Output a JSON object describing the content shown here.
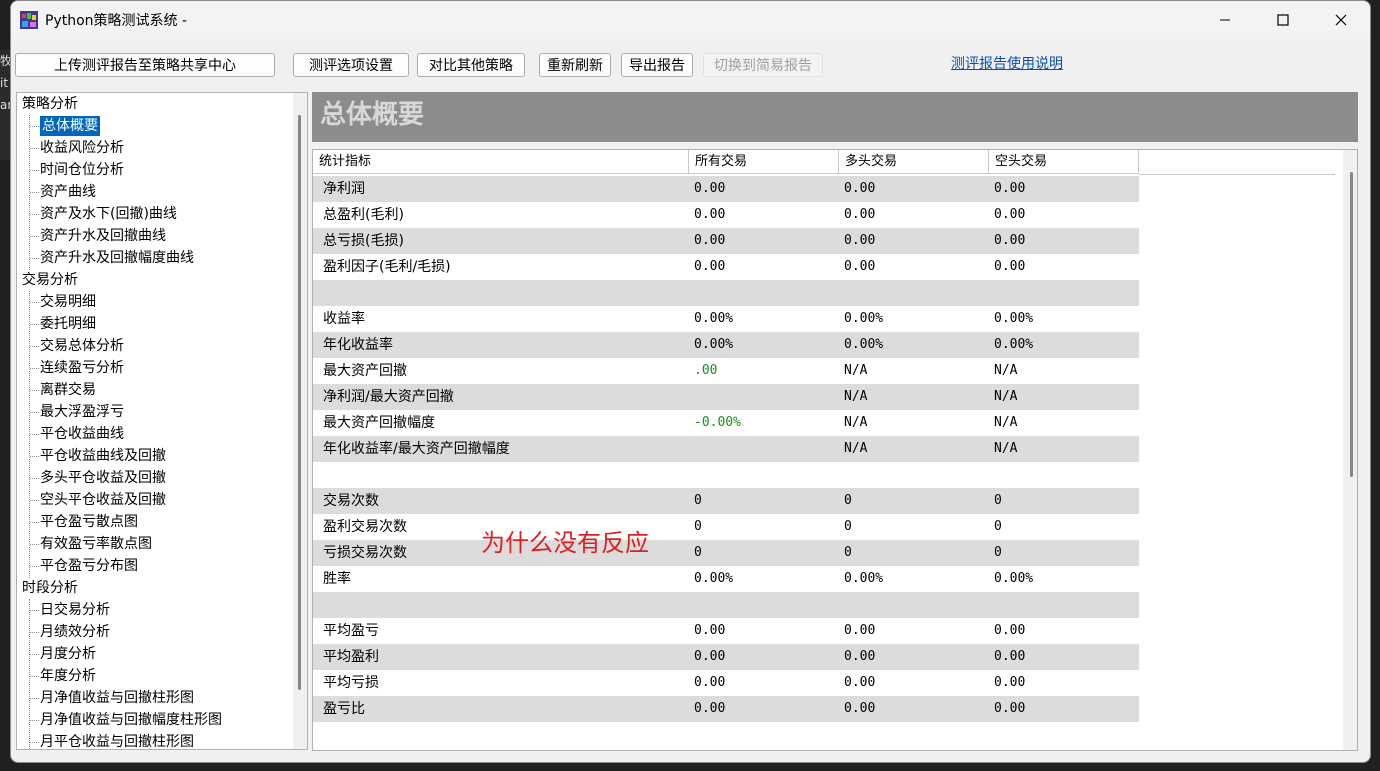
{
  "window": {
    "title": "Python策略测试系统 -"
  },
  "edge_fragments": [
    "牧",
    "it",
    "ar"
  ],
  "toolbar": {
    "upload": "上传测评报告至策略共享中心",
    "options": "测评选项设置",
    "compare": "对比其他策略",
    "refresh": "重新刷新",
    "export": "导出报告",
    "simple": "切换到简易报告",
    "help": "测评报告使用说明"
  },
  "tree": {
    "groups": [
      {
        "label": "策略分析",
        "items": [
          "总体概要",
          "收益风险分析",
          "时间仓位分析",
          "资产曲线",
          "资产及水下(回撤)曲线",
          "资产升水及回撤曲线",
          "资产升水及回撤幅度曲线"
        ]
      },
      {
        "label": "交易分析",
        "items": [
          "交易明细",
          "委托明细",
          "交易总体分析",
          "连续盈亏分析",
          "离群交易",
          "最大浮盈浮亏",
          "平仓收益曲线",
          "平仓收益曲线及回撤",
          "多头平仓收益及回撤",
          "空头平仓收益及回撤",
          "平仓盈亏散点图",
          "有效盈亏率散点图",
          "平仓盈亏分布图"
        ]
      },
      {
        "label": "时段分析",
        "items": [
          "日交易分析",
          "月绩效分析",
          "月度分析",
          "年度分析",
          "月净值收益与回撤柱形图",
          "月净值收益与回撤幅度柱形图",
          "月平仓收益与回撤柱形图"
        ]
      }
    ]
  },
  "panel": {
    "title": "总体概要"
  },
  "table": {
    "headers": [
      "统计指标",
      "所有交易",
      "多头交易",
      "空头交易"
    ],
    "rows": [
      {
        "label": "净利润",
        "all": "0.00",
        "long": "0.00",
        "short": "0.00"
      },
      {
        "label": "总盈利(毛利)",
        "all": "0.00",
        "long": "0.00",
        "short": "0.00"
      },
      {
        "label": "总亏损(毛损)",
        "all": "0.00",
        "long": "0.00",
        "short": "0.00"
      },
      {
        "label": "盈利因子(毛利/毛损)",
        "all": "0.00",
        "long": "0.00",
        "short": "0.00"
      },
      {
        "label": "",
        "all": "",
        "long": "",
        "short": ""
      },
      {
        "label": "收益率",
        "all": "0.00%",
        "long": "0.00%",
        "short": "0.00%"
      },
      {
        "label": "年化收益率",
        "all": "0.00%",
        "long": "0.00%",
        "short": "0.00%"
      },
      {
        "label": "最大资产回撤",
        "all": ".00",
        "long": "N/A",
        "short": "N/A",
        "all_color": "green"
      },
      {
        "label": "净利润/最大资产回撤",
        "all": "",
        "long": "N/A",
        "short": "N/A"
      },
      {
        "label": "最大资产回撤幅度",
        "all": "-0.00%",
        "long": "N/A",
        "short": "N/A",
        "all_color": "green"
      },
      {
        "label": "年化收益率/最大资产回撤幅度",
        "all": "",
        "long": "N/A",
        "short": "N/A"
      },
      {
        "label": "",
        "all": "",
        "long": "",
        "short": ""
      },
      {
        "label": "交易次数",
        "all": "0",
        "long": "0",
        "short": "0"
      },
      {
        "label": "盈利交易次数",
        "all": "0",
        "long": "0",
        "short": "0"
      },
      {
        "label": "亏损交易次数",
        "all": "0",
        "long": "0",
        "short": "0"
      },
      {
        "label": "胜率",
        "all": "0.00%",
        "long": "0.00%",
        "short": "0.00%"
      },
      {
        "label": "",
        "all": "",
        "long": "",
        "short": ""
      },
      {
        "label": "平均盈亏",
        "all": "0.00",
        "long": "0.00",
        "short": "0.00"
      },
      {
        "label": "平均盈利",
        "all": "0.00",
        "long": "0.00",
        "short": "0.00"
      },
      {
        "label": "平均亏损",
        "all": "0.00",
        "long": "0.00",
        "short": "0.00"
      },
      {
        "label": "盈亏比",
        "all": "0.00",
        "long": "0.00",
        "short": "0.00"
      }
    ]
  },
  "annotation": "为什么没有反应",
  "colors": {
    "selected": "#0067c0",
    "header_band": "#8c8c8c",
    "green": "#1a8f1a",
    "annotation": "#e02020"
  }
}
